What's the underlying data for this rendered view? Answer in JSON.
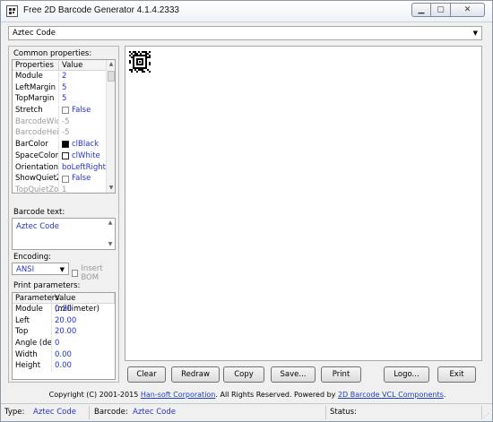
{
  "window": {
    "title": "Free 2D Barcode Generator 4.1.4.2333"
  },
  "barcode_type": "Aztec Code",
  "common_properties": {
    "label": "Common properties:",
    "headers": [
      "Properties",
      "Value"
    ],
    "rows": [
      {
        "key": "Module",
        "value": "2",
        "disabled": false
      },
      {
        "key": "LeftMargin",
        "value": "5",
        "disabled": false
      },
      {
        "key": "TopMargin",
        "value": "5",
        "disabled": false
      },
      {
        "key": "Stretch",
        "value": "False",
        "disabled": false,
        "checkbox": true
      },
      {
        "key": "BarcodeWidth",
        "value": "-5",
        "disabled": true
      },
      {
        "key": "BarcodeHeight",
        "value": "-5",
        "disabled": true
      },
      {
        "key": "BarColor",
        "value": "clBlack",
        "disabled": false,
        "swatch": "#000000"
      },
      {
        "key": "SpaceColor",
        "value": "clWhite",
        "disabled": false,
        "swatch": "#ffffff"
      },
      {
        "key": "Orientation",
        "value": "boLeftRight",
        "disabled": false
      },
      {
        "key": "ShowQuietZ…",
        "value": "False",
        "disabled": false,
        "checkbox": true
      },
      {
        "key": "TopQuietZone",
        "value": "1",
        "disabled": true
      }
    ]
  },
  "barcode_text": {
    "label": "Barcode text:",
    "value": "Aztec Code"
  },
  "encoding": {
    "label": "Encoding:",
    "value": "ANSI",
    "insert_bom_label": "Insert BOM"
  },
  "print_parameters": {
    "label": "Print parameters:",
    "headers": [
      "Parameters",
      "Value (millimeter)"
    ],
    "rows": [
      {
        "key": "Module",
        "value": "0.20"
      },
      {
        "key": "Left",
        "value": "20.00"
      },
      {
        "key": "Top",
        "value": "20.00"
      },
      {
        "key": "Angle (de…",
        "value": "0"
      },
      {
        "key": "Width",
        "value": "0.00"
      },
      {
        "key": "Height",
        "value": "0.00"
      }
    ]
  },
  "buttons": {
    "clear": "Clear",
    "redraw": "Redraw",
    "copy": "Copy",
    "save": "Save...",
    "print": "Print",
    "logo": "Logo...",
    "exit": "Exit"
  },
  "copyright": {
    "prefix": "Copyright (C) 2001-2015 ",
    "company": "Han-soft Corporation",
    "middle": ". All Rights Reserved.     Powered by ",
    "component": "2D Barcode VCL Components",
    "suffix": "."
  },
  "statusbar": {
    "type_label": "Type:",
    "type_value": "Aztec Code",
    "barcode_label": "Barcode:",
    "barcode_value": "Aztec Code",
    "status_label": "Status:"
  }
}
